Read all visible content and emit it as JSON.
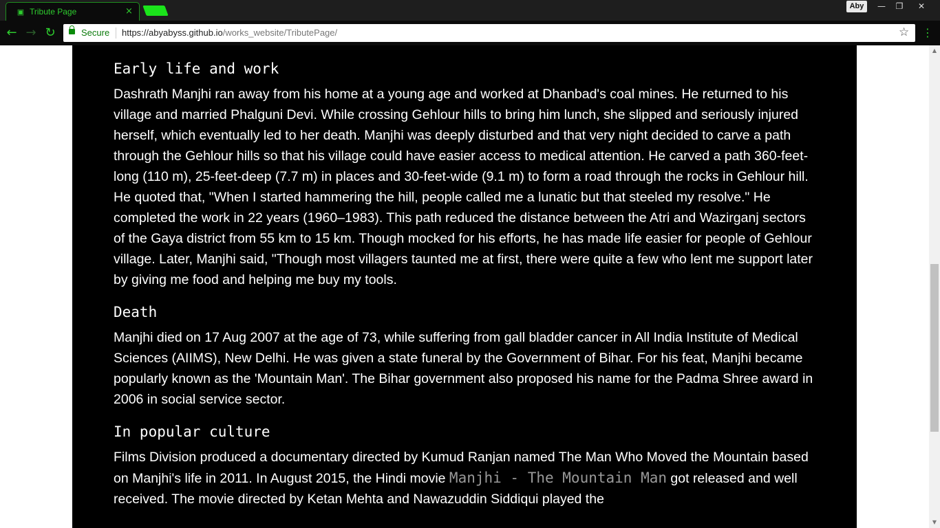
{
  "browser": {
    "tab_title": "Tribute Page",
    "tab_close": "×",
    "profile_name": "Aby",
    "window_controls": [
      "—",
      "❐",
      "✕"
    ],
    "secure_label": "Secure",
    "url_host": "https://abyabyss.github.io",
    "url_path": "/works_website/TributePage/",
    "icons": [
      "back-icon",
      "forward-icon",
      "reload-icon",
      "lock-icon",
      "star-icon",
      "menu-icon"
    ],
    "accent_color": "#2ecc2e"
  },
  "sections": [
    {
      "heading": "Early life and work",
      "text": "Dashrath Manjhi ran away from his home at a young age and worked at Dhanbad's coal mines. He returned to his village and married Phalguni Devi. While crossing Gehlour hills to bring him lunch, she slipped and seriously injured herself, which eventually led to her death. Manjhi was deeply disturbed and that very night decided to carve a path through the Gehlour hills so that his village could have easier access to medical attention. He carved a path 360-feet-long (110 m), 25-feet-deep (7.7 m) in places and 30-feet-wide (9.1 m) to form a road through the rocks in Gehlour hill. He quoted that, \"When I started hammering the hill, people called me a lunatic but that steeled my resolve.\" He completed the work in 22 years (1960–1983). This path reduced the distance between the Atri and Wazirganj sectors of the Gaya district from 55 km to 15 km. Though mocked for his efforts, he has made life easier for people of Gehlour village. Later, Manjhi said, \"Though most villagers taunted me at first, there were quite a few who lent me support later by giving me food and helping me buy my tools."
    },
    {
      "heading": "Death",
      "text": "Manjhi died on 17 Aug 2007 at the age of 73, while suffering from gall bladder cancer in All India Institute of Medical Sciences (AIIMS), New Delhi. He was given a state funeral by the Government of Bihar. For his feat, Manjhi became popularly known as the 'Mountain Man'. The Bihar government also proposed his name for the Padma Shree award in 2006 in social service sector."
    },
    {
      "heading": "In popular culture",
      "text_before": "Films Division produced a documentary directed by Kumud Ranjan named The Man Who Moved the Mountain based on Manjhi's life in 2011. In August 2015, the Hindi movie ",
      "movie_title": "Manjhi - The Mountain Man",
      "text_after": " got released and well received. The movie directed by Ketan Mehta and Nawazuddin Siddiqui played the"
    }
  ]
}
